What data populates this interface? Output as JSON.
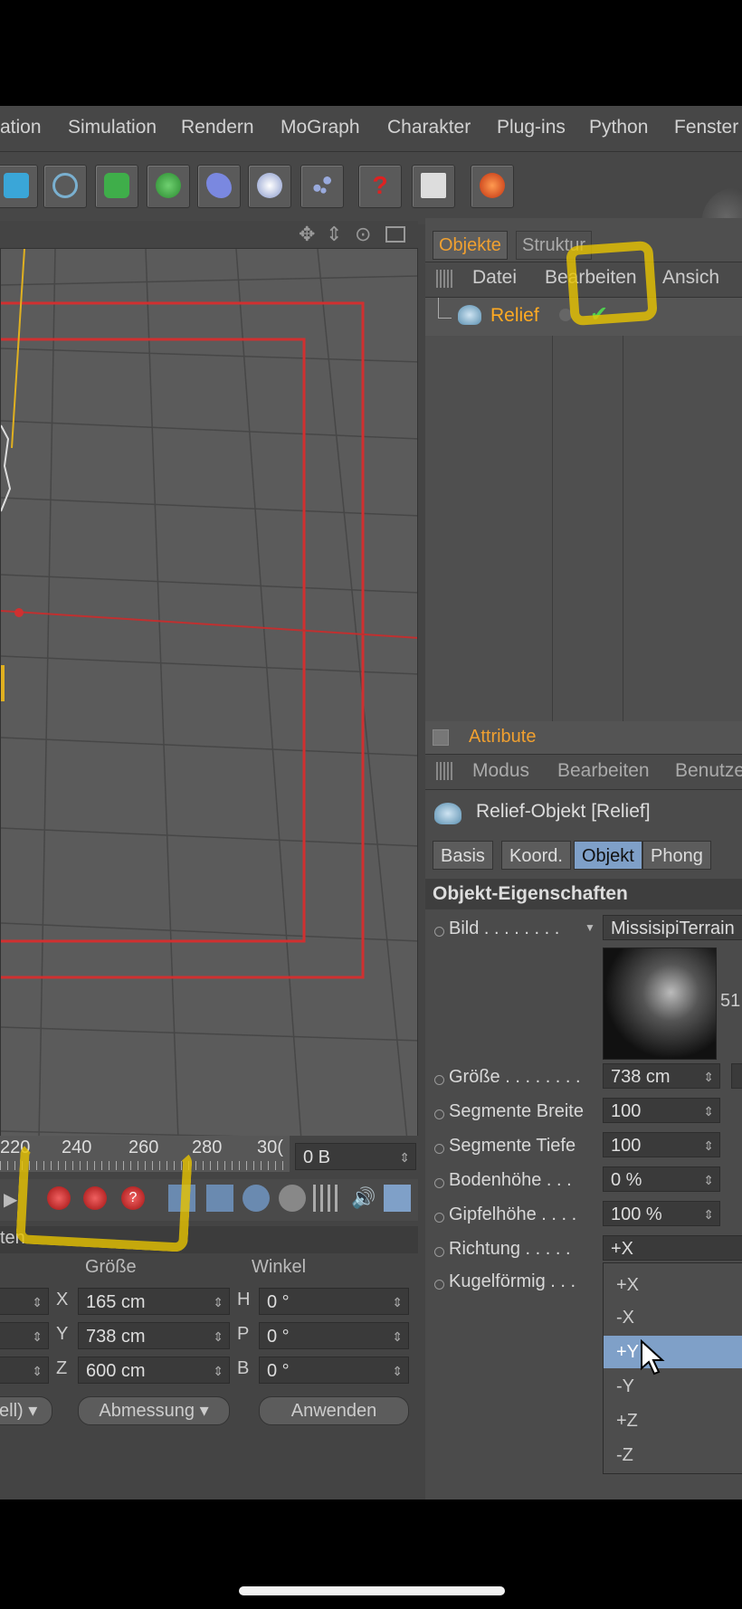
{
  "menubar": {
    "items": [
      "ation",
      "Simulation",
      "Rendern",
      "MoGraph",
      "Charakter",
      "Plug-ins",
      "Python",
      "Fenster"
    ]
  },
  "toolbar": {
    "icons": [
      "cube-icon",
      "spline-icon",
      "nurbs-icon",
      "array-icon",
      "deformer-icon",
      "scene-icon",
      "particles-icon",
      "help-icon",
      "layout-icon",
      "render-icon"
    ]
  },
  "objects_panel": {
    "tabs": [
      "Objekte",
      "Struktur"
    ],
    "menu": [
      "Datei",
      "Bearbeiten",
      "Ansich"
    ],
    "tree": [
      {
        "name": "Relief"
      }
    ]
  },
  "attribute_panel": {
    "title": "Attribute",
    "menu": [
      "Modus",
      "Bearbeiten",
      "Benutze"
    ],
    "object_title": "Relief-Objekt [Relief]",
    "tabs": [
      "Basis",
      "Koord.",
      "Objekt",
      "Phong"
    ],
    "active_tab": "Objekt",
    "section": "Objekt-Eigenschaften",
    "bild_label": "Bild . . . . . . . .",
    "bild_value": "MissisipiTerrain",
    "bild_suffix": "51",
    "groesse_label": "Größe . . . . . . . .",
    "groesse_value": "738 cm",
    "segmente_breite_label": "Segmente Breite",
    "segmente_breite_value": "100",
    "segmente_tiefe_label": "Segmente Tiefe",
    "segmente_tiefe_value": "100",
    "bodenhoehe_label": "Bodenhöhe . . .",
    "bodenhoehe_value": "0 %",
    "gipfelhoehe_label": "Gipfelhöhe . . . .",
    "gipfelhoehe_value": "100 %",
    "richtung_label": "Richtung . . . . .",
    "richtung_value": "+X",
    "kugelfoermig_label": "Kugelförmig . . .",
    "direction_options": [
      "+X",
      "-X",
      "+Y",
      "-Y",
      "+Z",
      "-Z"
    ],
    "direction_hover": "+Y"
  },
  "timeline": {
    "ticks": [
      "220",
      "240",
      "260",
      "280",
      "30("
    ],
    "frame_field": "0 B"
  },
  "coordinates": {
    "tab_fragment": "ten",
    "col_groesse": "Größe",
    "col_winkel": "Winkel",
    "rows": [
      {
        "axis": "X",
        "size": "165 cm",
        "angle_axis": "H",
        "angle": "0 °"
      },
      {
        "axis": "Y",
        "size": "738 cm",
        "angle_axis": "P",
        "angle": "0 °"
      },
      {
        "axis": "Z",
        "size": "600 cm",
        "angle_axis": "B",
        "angle": "0 °"
      }
    ],
    "left_dropdown": "ell)",
    "abmessung": "Abmessung",
    "anwenden": "Anwenden"
  },
  "colors": {
    "highlight": "#e8c400",
    "active_tab": "#7fa0c8",
    "red_frame": "#d03030",
    "axis_yellow": "#e0b020",
    "relief_orange": "#ffaa22"
  }
}
